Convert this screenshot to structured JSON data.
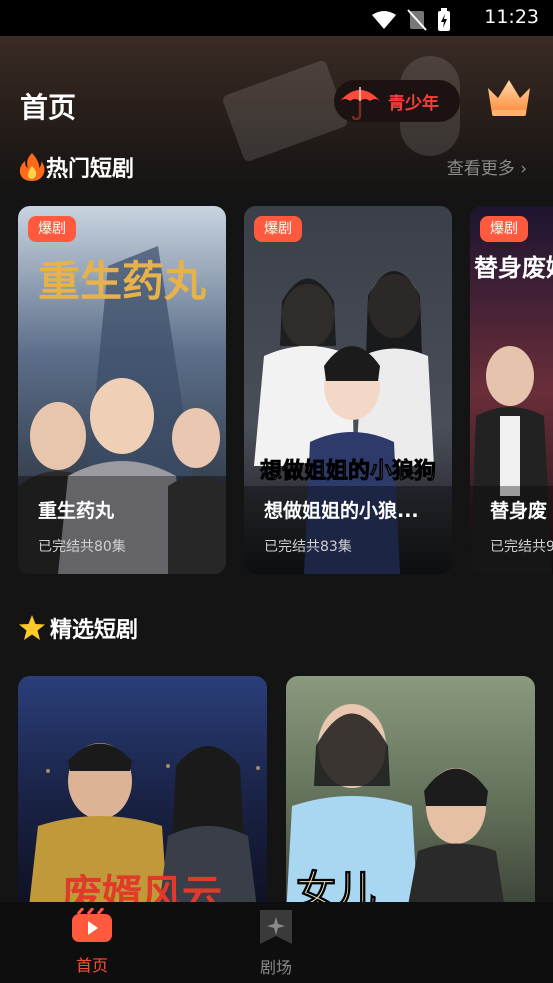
{
  "status_bar": {
    "time": "11:23"
  },
  "header": {
    "title": "首页",
    "teen_mode_label": "青少年"
  },
  "hot_section": {
    "title": "热门短剧",
    "see_more": "查看更多",
    "items": [
      {
        "badge": "爆剧",
        "name": "重生药丸",
        "meta": "已完结共80集",
        "poster_text": "重生药丸"
      },
      {
        "badge": "爆剧",
        "name": "想做姐姐的小狼...",
        "meta": "已完结共83集",
        "poster_text": "想做姐姐的小狼狗"
      },
      {
        "badge": "爆剧",
        "name": "替身废",
        "meta": "已完结共9",
        "poster_text": "替身废婿"
      }
    ]
  },
  "featured_section": {
    "title": "精选短剧",
    "items": [
      {
        "poster_text": "废婿风云"
      },
      {
        "poster_text": "女儿"
      }
    ]
  },
  "bottom_nav": {
    "items": [
      {
        "label": "首页",
        "active": true
      },
      {
        "label": "剧场",
        "active": false
      }
    ]
  },
  "colors": {
    "accent": "#ff5a3d",
    "teen_red": "#ff3b3b",
    "nav_active": "#ff4d3a",
    "nav_inactive": "#8a8a8a"
  }
}
